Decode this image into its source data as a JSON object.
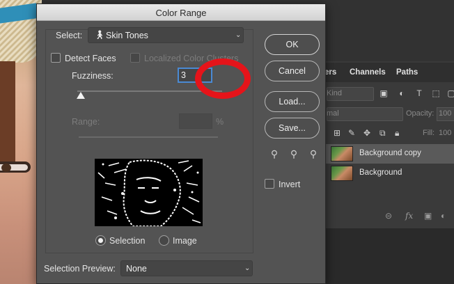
{
  "dialog": {
    "title": "Color Range",
    "select_label": "Select:",
    "select_value": "Skin Tones",
    "detect_faces_label": "Detect Faces",
    "localized_label": "Localized Color Clusters",
    "fuzziness_label": "Fuzziness:",
    "fuzziness_value": "3",
    "range_label": "Range:",
    "range_unit": "%",
    "selection_label": "Selection",
    "image_label": "Image",
    "selection_preview_label": "Selection Preview:",
    "selection_preview_value": "None",
    "invert_label": "Invert",
    "fuzziness_level": 0.0,
    "buttons": {
      "ok": "OK",
      "cancel": "Cancel",
      "load": "Load...",
      "save": "Save..."
    }
  },
  "layers_panel": {
    "tabs": [
      "ers",
      "Channels",
      "Paths"
    ],
    "kind_placeholder": "Kind",
    "blend_mode": "mal",
    "opacity_label": "Opacity:",
    "opacity_value": "100",
    "fill_label": "Fill:",
    "fill_value": "100",
    "layers": [
      "Background copy",
      "Background"
    ]
  },
  "colors": {
    "annotation": "#e5141a",
    "focus": "#4a8ad4"
  }
}
